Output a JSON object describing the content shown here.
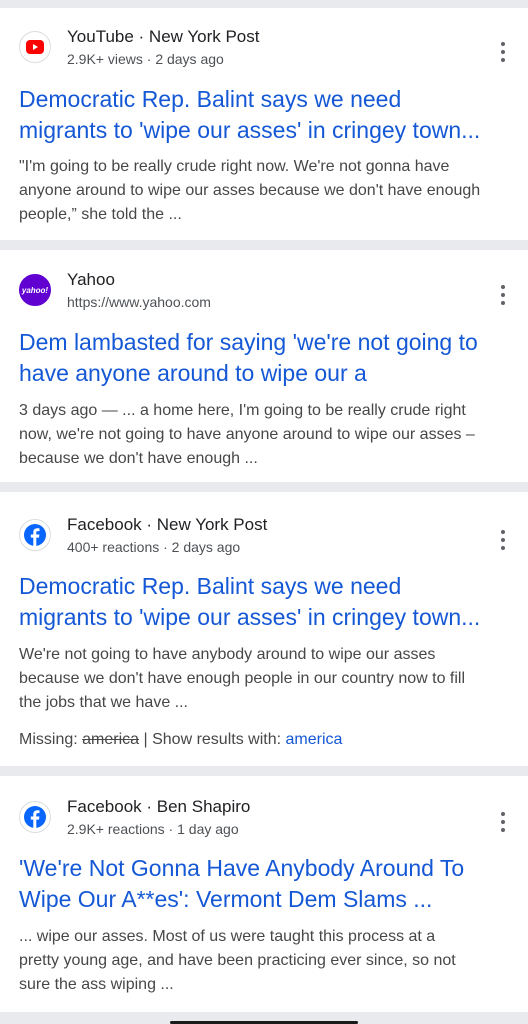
{
  "results": [
    {
      "source": "YouTube · New York Post",
      "meta": "2.9K+ views · 2 days ago",
      "icon": "youtube-icon",
      "title_line1": "Democratic Rep. Balint says we need",
      "title_line2": "migrants to 'wipe our asses' in cringey town...",
      "snippet_lines": [
        "\"I'm going to be really crude right now. We're not gonna have",
        "anyone around to wipe our asses because we don't have enough",
        "people,” she told the ..."
      ]
    },
    {
      "source": "Yahoo",
      "meta": "https://www.yahoo.com",
      "icon": "yahoo-icon",
      "icon_text": "yahoo!",
      "title_line1": "Dem lambasted for saying 'we're not going to",
      "title_line2": "have anyone around to wipe our a",
      "snippet_lines": [
        "3 days ago — ... a home here, I'm going to be really crude right",
        "now, we're not going to have anyone around to wipe our asses –",
        "because we don't have enough ..."
      ]
    },
    {
      "source": "Facebook · New York Post",
      "meta": "400+ reactions · 2 days ago",
      "icon": "facebook-icon",
      "title_line1": "Democratic Rep. Balint says we need",
      "title_line2": "migrants to 'wipe our asses' in cringey town...",
      "snippet_lines": [
        "We're not going to have anybody around to wipe our asses",
        "because we don't have enough people in our country now to fill",
        "the jobs that we have ..."
      ],
      "missing_label": "Missing:",
      "missing_term": "america",
      "show_with": "| Show results with:",
      "show_term": "america"
    },
    {
      "source": "Facebook · Ben Shapiro",
      "meta": "2.9K+ reactions · 1 day ago",
      "icon": "facebook-icon",
      "title_line1": "'We're Not Gonna Have Anybody Around To",
      "title_line2": "Wipe Our A**es': Vermont Dem Slams ...",
      "snippet_lines": [
        "... wipe our asses. Most of us were taught this process at a",
        "pretty young age, and have been practicing ever since, so not",
        "sure the ass wiping ..."
      ]
    }
  ],
  "colors": {
    "link": "#1558d6",
    "youtube_red": "#ff0000",
    "yahoo_purple": "#6001d2",
    "facebook_blue": "#0866ff"
  }
}
